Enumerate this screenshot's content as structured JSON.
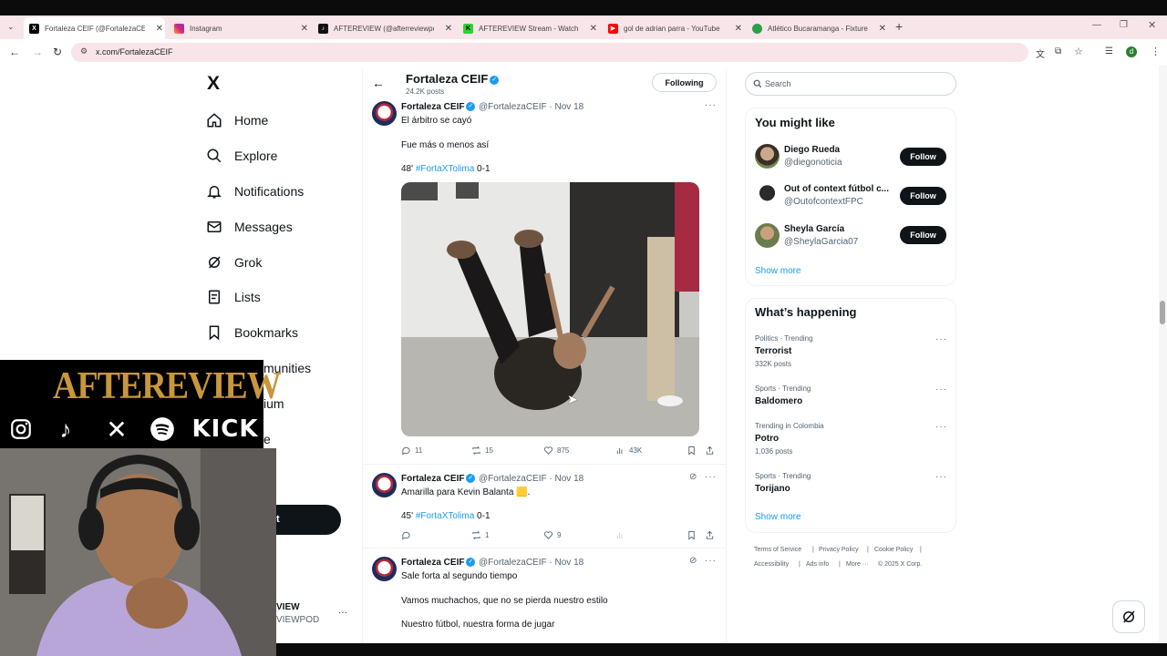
{
  "browser": {
    "tabs": [
      {
        "title": "Fortaleza CEIF (@FortalezaCEIF",
        "active": true
      },
      {
        "title": "Instagram"
      },
      {
        "title": "AFTEREVIEW (@afterreviewpod)"
      },
      {
        "title": "AFTEREVIEW Stream - Watch Li"
      },
      {
        "title": "gol de adrian parra - YouTube"
      },
      {
        "title": "Atlético Bucaramanga - Fixture"
      }
    ],
    "url": "x.com/FortalezaCEIF"
  },
  "nav": {
    "logo": "X",
    "items": [
      {
        "label": "Home"
      },
      {
        "label": "Explore"
      },
      {
        "label": "Notifications"
      },
      {
        "label": "Messages"
      },
      {
        "label": "Grok"
      },
      {
        "label": "Lists"
      },
      {
        "label": "Bookmarks"
      },
      {
        "label": "munities"
      },
      {
        "label": "ium"
      },
      {
        "label": "e"
      }
    ],
    "post_button_fragment": "t",
    "account_name_fragment": "VIEW",
    "account_handle_fragment": "VIEWPOD"
  },
  "overlay": {
    "logo_text": "AFTEREVIEW",
    "social": [
      "instagram-icon",
      "tiktok-icon",
      "x-icon",
      "spotify-icon",
      "kick-logo"
    ],
    "kick_label": "KICK"
  },
  "profile_header": {
    "name": "Fortaleza CEIF",
    "posts_count": "24.2K posts",
    "following_label": "Following"
  },
  "tweets": [
    {
      "name": "Fortaleza CEIF",
      "handle": "@FortalezaCEIF",
      "date": "· Nov 18",
      "lines": [
        "El árbitro se cayó",
        "Fue más o menos así"
      ],
      "hashtag_line": {
        "prefix": "48' ",
        "hashtag": "#FortaXTolima",
        "suffix": " 0-1"
      },
      "replies": "11",
      "reposts": "15",
      "likes": "875",
      "views": "43K"
    },
    {
      "name": "Fortaleza CEIF",
      "handle": "@FortalezaCEIF",
      "date": "· Nov 18",
      "lines": [
        "Amarilla para Kevin Balanta 🟨."
      ],
      "hashtag_line": {
        "prefix": "45' ",
        "hashtag": "#FortaXTolima",
        "suffix": " 0-1"
      },
      "replies": "",
      "reposts": "1",
      "likes": "9",
      "views": ""
    },
    {
      "name": "Fortaleza CEIF",
      "handle": "@FortalezaCEIF",
      "date": "· Nov 18",
      "lines": [
        "Sale forta al segundo tiempo",
        "Vamos muchachos, que no se pierda nuestro estilo",
        "Nuestro fútbol, nuestra forma de jugar"
      ]
    }
  ],
  "search": {
    "placeholder": "Search"
  },
  "you_might_like": {
    "title": "You might like",
    "users": [
      {
        "name": "Diego Rueda",
        "handle": "@diegonoticia",
        "button": "Follow"
      },
      {
        "name": "Out of context fútbol c...",
        "handle": "@OutofcontextFPC",
        "button": "Follow"
      },
      {
        "name": "Sheyla García",
        "handle": "@SheylaGarcia07",
        "button": "Follow"
      }
    ],
    "show_more": "Show more"
  },
  "whats_happening": {
    "title": "What’s happening",
    "trends": [
      {
        "context": "Politics · Trending",
        "name": "Terrorist",
        "posts": "332K posts"
      },
      {
        "context": "Sports · Trending",
        "name": "Baldomero",
        "posts": ""
      },
      {
        "context": "Trending in Colombia",
        "name": "Potro",
        "posts": "1,036 posts"
      },
      {
        "context": "Sports · Trending",
        "name": "Torijano",
        "posts": ""
      }
    ],
    "show_more": "Show more"
  },
  "footer": {
    "links": [
      "Terms of Service",
      "Privacy Policy",
      "Cookie Policy",
      "Accessibility",
      "Ads info",
      "More ···",
      "© 2025 X Corp."
    ]
  },
  "colors": {
    "accent": "#1d9bf0",
    "text": "#0f1419",
    "muted": "#536471",
    "tabstrip": "#f8e5e9"
  }
}
